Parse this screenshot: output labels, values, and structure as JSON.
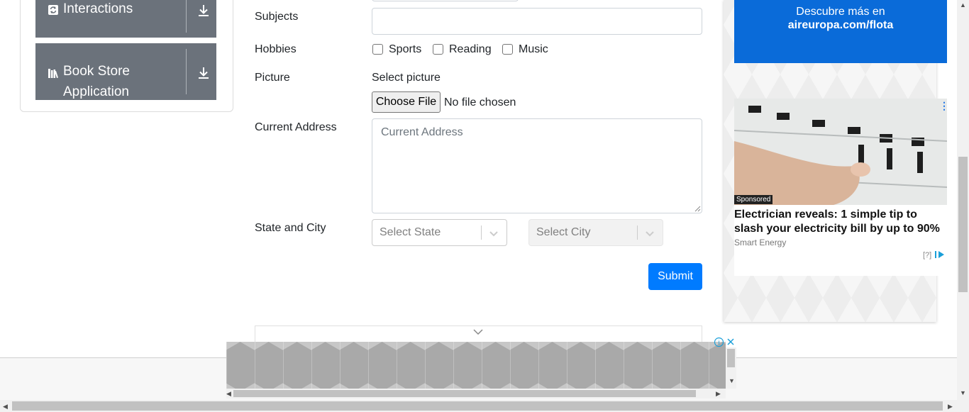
{
  "sidebar": {
    "groups": [
      {
        "label": "Interactions",
        "icon": "refresh-icon"
      },
      {
        "label_line1": "Book Store",
        "label_line2": "Application",
        "icon": "books-icon"
      }
    ]
  },
  "form": {
    "subjects_label": "Subjects",
    "subjects_value": "",
    "hobbies_label": "Hobbies",
    "hobbies": [
      {
        "label": "Sports",
        "checked": false
      },
      {
        "label": "Reading",
        "checked": false
      },
      {
        "label": "Music",
        "checked": false
      }
    ],
    "picture_label": "Picture",
    "select_picture": "Select picture",
    "choose_file": "Choose File",
    "no_file": "No file chosen",
    "address_label": "Current Address",
    "address_placeholder": "Current Address",
    "state_city_label": "State and City",
    "state_placeholder": "Select State",
    "city_placeholder": "Select City",
    "submit": "Submit"
  },
  "ads": {
    "blue_ad_line1": "Descubre más en",
    "blue_ad_line2": "aireuropa.com/flota",
    "sponsored_tag": "Sponsored",
    "headline": "Electrician reveals: 1 simple tip to slash your electricity bill by up to 90%",
    "source": "Smart Energy",
    "adchoice": "[?]"
  },
  "colors": {
    "primary": "#007bff",
    "sidebar": "#6b727b",
    "blue_ad": "#0a6bd9"
  }
}
